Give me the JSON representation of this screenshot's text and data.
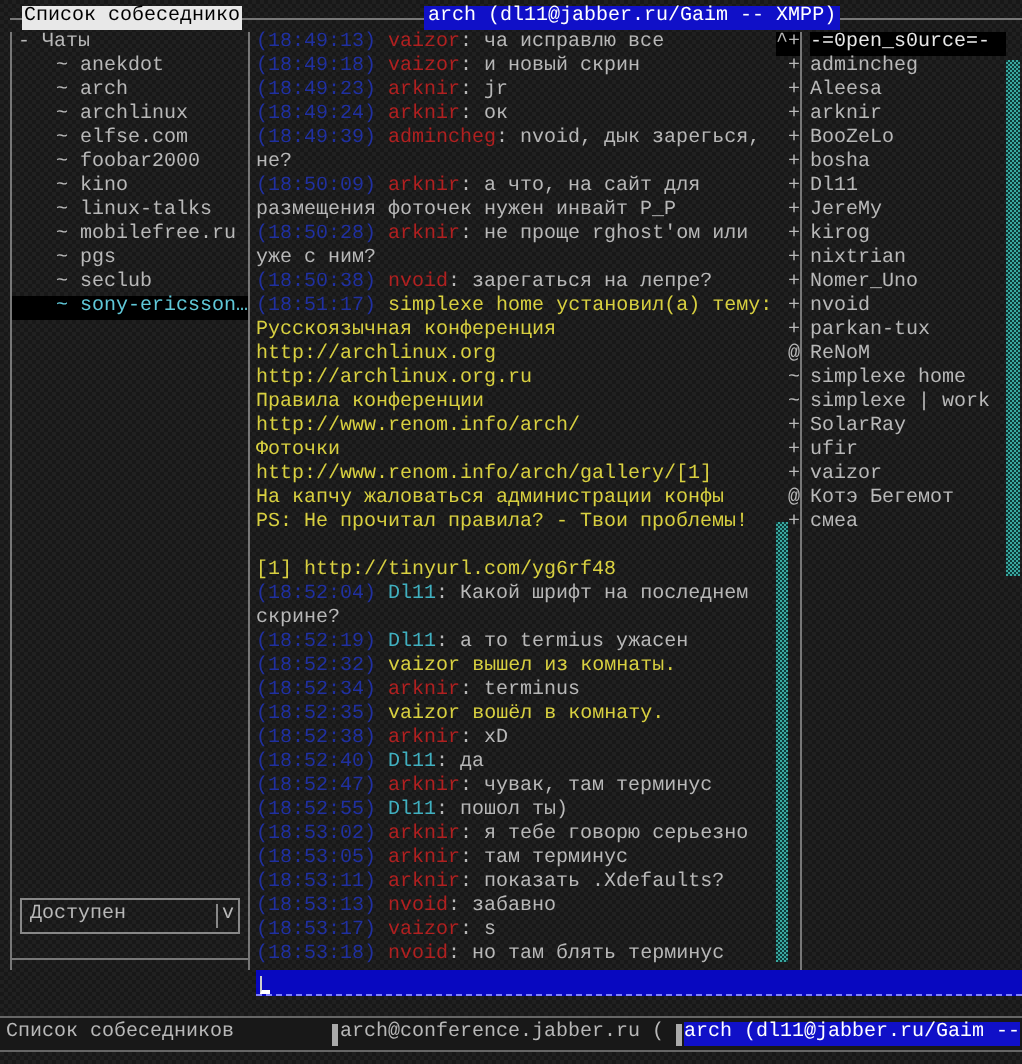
{
  "contacts_panel": {
    "title": "Список собеседнико",
    "tree": [
      {
        "prefix": "-",
        "label": "Чаты",
        "children": [
          {
            "prefix": "~",
            "label": "anekdot",
            "selected": false
          },
          {
            "prefix": "~",
            "label": "arch",
            "selected": false
          },
          {
            "prefix": "~",
            "label": "archlinux",
            "selected": false
          },
          {
            "prefix": "~",
            "label": "elfse.com",
            "selected": false
          },
          {
            "prefix": "~",
            "label": "foobar2000",
            "selected": false
          },
          {
            "prefix": "~",
            "label": "kino",
            "selected": false
          },
          {
            "prefix": "~",
            "label": "linux-talks",
            "selected": false
          },
          {
            "prefix": "~",
            "label": "mobilefree.ru",
            "selected": false
          },
          {
            "prefix": "~",
            "label": "pgs",
            "selected": false
          },
          {
            "prefix": "~",
            "label": "seclub",
            "selected": false
          },
          {
            "prefix": "~",
            "label": "sony-ericsson…",
            "selected": true
          }
        ]
      }
    ],
    "status": {
      "value": "Доступен",
      "dropdown": "v"
    }
  },
  "chat": {
    "title": "arch (dl11@jabber.ru/Gaim -- XMPP)",
    "messages": [
      {
        "kind": "message",
        "time": "(18:49:13)",
        "nick": "vaizor",
        "color": "#b02020",
        "text": ": ча исправлю все"
      },
      {
        "kind": "message",
        "time": "(18:49:18)",
        "nick": "vaizor",
        "color": "#b02020",
        "text": ": и новый скрин"
      },
      {
        "kind": "message",
        "time": "(18:49:23)",
        "nick": "arknir",
        "color": "#b02020",
        "text": ": jr"
      },
      {
        "kind": "message",
        "time": "(18:49:24)",
        "nick": "arknir",
        "color": "#b02020",
        "text": ": ок"
      },
      {
        "kind": "message",
        "time": "(18:49:39)",
        "nick": "admincheg",
        "color": "#b02020",
        "text": ": nvoid, дык зарегься, не?"
      },
      {
        "kind": "message",
        "time": "(18:50:09)",
        "nick": "arknir",
        "color": "#b02020",
        "text": ": а что, на сайт для размещения фоточек нужен инвайт P_P"
      },
      {
        "kind": "message",
        "time": "(18:50:28)",
        "nick": "arknir",
        "color": "#b02020",
        "text": ": не проще rghost'ом или уже с ним?"
      },
      {
        "kind": "message",
        "time": "(18:50:38)",
        "nick": "nvoid",
        "color": "#b02020",
        "text": ": зарегаться на лепре?"
      },
      {
        "kind": "event",
        "time": "(18:51:17)",
        "nick": "simplexe home",
        "text": "установил(а) тему:"
      },
      {
        "kind": "topic",
        "text": "Русскоязычная конференция"
      },
      {
        "kind": "topic",
        "text": "http://archlinux.org"
      },
      {
        "kind": "topic",
        "text": "http://archlinux.org.ru"
      },
      {
        "kind": "topic",
        "text": "Правила конференции"
      },
      {
        "kind": "topic",
        "text": "http://www.renom.info/arch/"
      },
      {
        "kind": "topic",
        "text": "Фоточки"
      },
      {
        "kind": "topic",
        "text": "http://www.renom.info/arch/gallery/[1]"
      },
      {
        "kind": "topic",
        "text": "На капчу жаловаться администрации конфы"
      },
      {
        "kind": "topic",
        "text": "PS: Не прочитал правила? - Твои проблемы!"
      },
      {
        "kind": "blank"
      },
      {
        "kind": "topic",
        "text": "[1] http://tinyurl.com/yg6rf48"
      },
      {
        "kind": "message",
        "time": "(18:52:04)",
        "nick": "Dl11",
        "color": "#40b0c0",
        "text": ": Какой шрифт на последнем скрине?"
      },
      {
        "kind": "message",
        "time": "(18:52:19)",
        "nick": "Dl11",
        "color": "#40b0c0",
        "text": ": а то termius ужасен"
      },
      {
        "kind": "event",
        "time": "(18:52:32)",
        "nick": "vaizor",
        "text": "вышел из комнаты."
      },
      {
        "kind": "message",
        "time": "(18:52:34)",
        "nick": "arknir",
        "color": "#b02020",
        "text": ": terminus"
      },
      {
        "kind": "event",
        "time": "(18:52:35)",
        "nick": "vaizor",
        "text": "вошёл в комнату."
      },
      {
        "kind": "message",
        "time": "(18:52:38)",
        "nick": "arknir",
        "color": "#b02020",
        "text": ": xD"
      },
      {
        "kind": "message",
        "time": "(18:52:40)",
        "nick": "Dl11",
        "color": "#40b0c0",
        "text": ": да"
      },
      {
        "kind": "message",
        "time": "(18:52:47)",
        "nick": "arknir",
        "color": "#b02020",
        "text": ": чувак, там терминус"
      },
      {
        "kind": "message",
        "time": "(18:52:55)",
        "nick": "Dl11",
        "color": "#40b0c0",
        "text": ": пошол ты)"
      },
      {
        "kind": "message",
        "time": "(18:53:02)",
        "nick": "arknir",
        "color": "#b02020",
        "text": ": я тебе говорю серьезно"
      },
      {
        "kind": "message",
        "time": "(18:53:05)",
        "nick": "arknir",
        "color": "#b02020",
        "text": ": там терминус"
      },
      {
        "kind": "message",
        "time": "(18:53:11)",
        "nick": "arknir",
        "color": "#b02020",
        "text": ": показать .Xdefaults?"
      },
      {
        "kind": "message",
        "time": "(18:53:13)",
        "nick": "nvoid",
        "color": "#b02020",
        "text": ": забавно"
      },
      {
        "kind": "message",
        "time": "(18:53:17)",
        "nick": "vaizor",
        "color": "#b02020",
        "text": ": s"
      },
      {
        "kind": "message",
        "time": "(18:53:18)",
        "nick": "nvoid",
        "color": "#b02020",
        "text": ": но там блять терминус"
      }
    ]
  },
  "participants": [
    {
      "prefix": "^+",
      "name": "-=0pen_s0urce=-",
      "selected": true
    },
    {
      "prefix": "+",
      "name": "admincheg",
      "selected": false
    },
    {
      "prefix": "+",
      "name": "Aleesa",
      "selected": false
    },
    {
      "prefix": "+",
      "name": "arknir",
      "selected": false
    },
    {
      "prefix": "+",
      "name": "BooZeLo",
      "selected": false
    },
    {
      "prefix": "+",
      "name": "bosha",
      "selected": false
    },
    {
      "prefix": "+",
      "name": "Dl11",
      "selected": false
    },
    {
      "prefix": "+",
      "name": "JereMy",
      "selected": false
    },
    {
      "prefix": "+",
      "name": "kirog",
      "selected": false
    },
    {
      "prefix": "+",
      "name": "nixtrian",
      "selected": false
    },
    {
      "prefix": "+",
      "name": "Nomer_Uno",
      "selected": false
    },
    {
      "prefix": "+",
      "name": "nvoid",
      "selected": false
    },
    {
      "prefix": "+",
      "name": "parkan-tux",
      "selected": false
    },
    {
      "prefix": "@",
      "name": "ReNoM",
      "selected": false
    },
    {
      "prefix": "~",
      "name": "simplexe home",
      "selected": false
    },
    {
      "prefix": "~",
      "name": "simplexe | work",
      "selected": false
    },
    {
      "prefix": "+",
      "name": "SolarRay",
      "selected": false
    },
    {
      "prefix": "+",
      "name": "ufir",
      "selected": false
    },
    {
      "prefix": "+",
      "name": "vaizor",
      "selected": false
    },
    {
      "prefix": "@",
      "name": "Котэ Бегемот",
      "selected": false
    },
    {
      "prefix": "+",
      "name": "смеа",
      "selected": false
    }
  ],
  "status_bar": {
    "label": "Список собеседников",
    "tabs": [
      {
        "label": "arch@conference.jabber.ru (",
        "selected": false
      },
      {
        "label": "arch (dl11@jabber.ru/Gaim --",
        "selected": true
      }
    ]
  }
}
